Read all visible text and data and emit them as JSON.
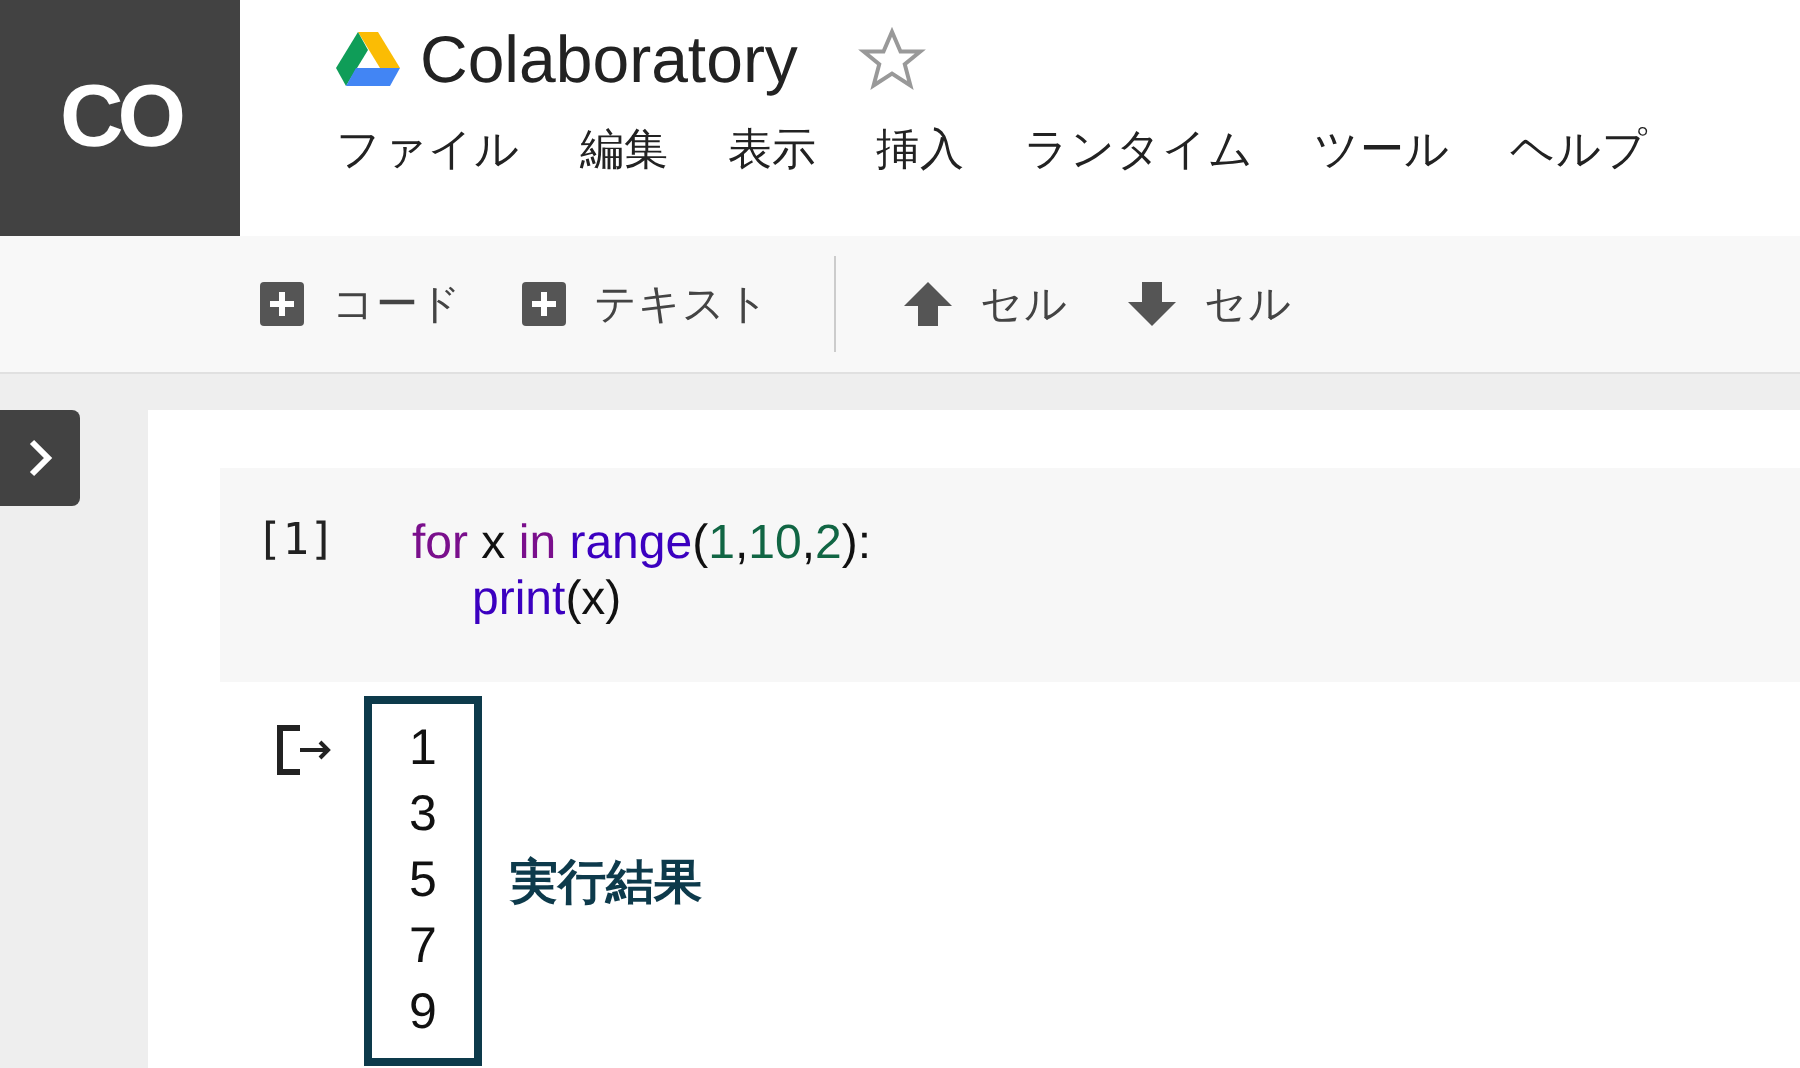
{
  "logo": {
    "text": "CO"
  },
  "title": "Colaboratory",
  "starred": false,
  "menu": [
    "ファイル",
    "編集",
    "表示",
    "挿入",
    "ランタイム",
    "ツール",
    "ヘルプ"
  ],
  "toolbar": [
    {
      "kind": "add",
      "label": "コード"
    },
    {
      "kind": "add",
      "label": "テキスト"
    },
    {
      "kind": "up",
      "label": "セル"
    },
    {
      "kind": "down",
      "label": "セル"
    }
  ],
  "cell": {
    "count": "[1]",
    "lines": [
      {
        "indent": false,
        "tokens": [
          {
            "kind": "keyword",
            "text": "for"
          },
          {
            "kind": "plain",
            "text": " x "
          },
          {
            "kind": "keyword",
            "text": "in "
          },
          {
            "kind": "builtin",
            "text": "range"
          },
          {
            "kind": "plain",
            "text": "("
          },
          {
            "kind": "number",
            "text": "1"
          },
          {
            "kind": "plain",
            "text": ","
          },
          {
            "kind": "number",
            "text": "10"
          },
          {
            "kind": "plain",
            "text": ","
          },
          {
            "kind": "number",
            "text": "2"
          },
          {
            "kind": "plain",
            "text": "):"
          }
        ]
      },
      {
        "indent": true,
        "tokens": [
          {
            "kind": "builtin",
            "text": "print"
          },
          {
            "kind": "plain",
            "text": "(x)"
          }
        ]
      }
    ]
  },
  "output": {
    "lines": [
      "1",
      "3",
      "5",
      "7",
      "9"
    ],
    "annotation": "実行結果"
  }
}
